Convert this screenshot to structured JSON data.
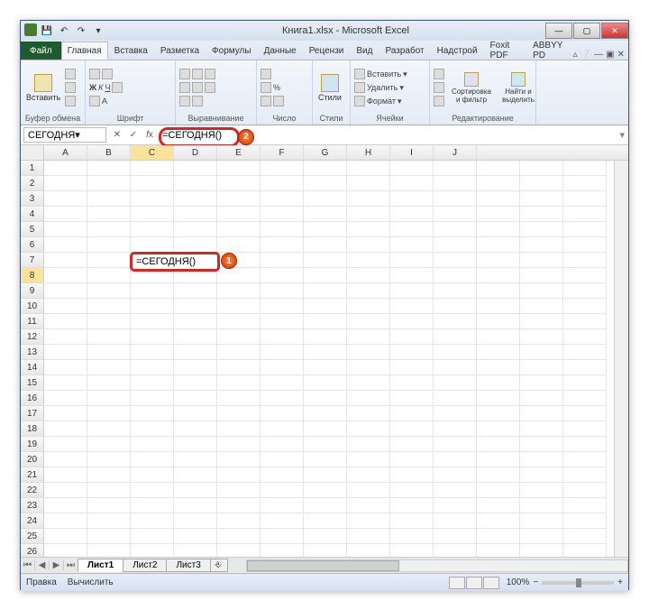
{
  "title": "Книга1.xlsx - Microsoft Excel",
  "tabs": {
    "file": "Файл",
    "list": [
      "Главная",
      "Вставка",
      "Разметка",
      "Формулы",
      "Данные",
      "Рецензи",
      "Вид",
      "Разработ",
      "Надстрой",
      "Foxit PDF",
      "ABBYY PD"
    ],
    "active": 0
  },
  "ribbon": {
    "groups": {
      "clipboard": {
        "label": "Буфер обмена",
        "paste": "Вставить"
      },
      "font": {
        "label": "Шрифт"
      },
      "alignment": {
        "label": "Выравнивание"
      },
      "number": {
        "label": "Число"
      },
      "styles": {
        "label": "Стили",
        "btn": "Стили"
      },
      "cells": {
        "label": "Ячейки",
        "insert": "Вставить",
        "delete": "Удалить",
        "format": "Формат"
      },
      "editing": {
        "label": "Редактирование",
        "sort": "Сортировка и фильтр",
        "find": "Найти и выделить"
      }
    }
  },
  "namebox": "СЕГОДНЯ",
  "formula": "=СЕГОДНЯ()",
  "cell_formula": "=СЕГОДНЯ()",
  "columns": [
    "A",
    "B",
    "C",
    "D",
    "E",
    "F",
    "G",
    "H",
    "I",
    "J"
  ],
  "active_col": "C",
  "active_row": 8,
  "sheets": [
    "Лист1",
    "Лист2",
    "Лист3"
  ],
  "active_sheet": 0,
  "status": {
    "left1": "Правка",
    "left2": "Вычислить",
    "zoom": "100%"
  },
  "badges": {
    "cell": "1",
    "formula": "2"
  }
}
